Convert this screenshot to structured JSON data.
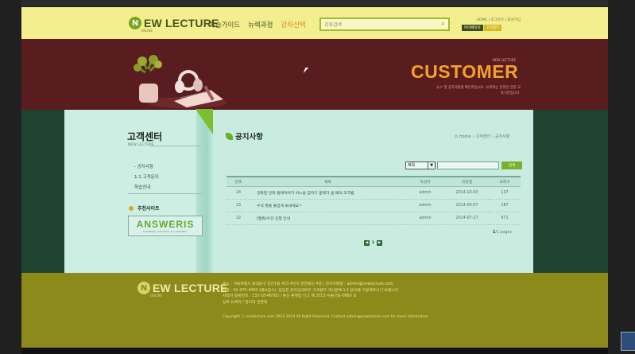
{
  "header": {
    "logo_mark": "N",
    "logo_text": "EW LECTURE",
    "logo_sub": "ONLINE",
    "nav": [
      "학습가이드",
      "뉴렉과정",
      "강좌선택"
    ],
    "search_placeholder": "강좌검색",
    "util_links": "HOME | 로그아웃 | 회원가입",
    "mypage_label": "마이페이지",
    "customer_label": "고객센터"
  },
  "banner": {
    "small": "NEW LECTURE",
    "title": "CUSTOMER",
    "desc": "뉴스 및 공지사항을 확인하십시오. 뉴렉처는 온라인 전문 교육기관입니다."
  },
  "sidebar": {
    "title": "고객센터",
    "subtitle": "NEW LECTURE",
    "menu": [
      "- 공지사항",
      "1:1 고객문의",
      "학습안내"
    ],
    "recommend_label": "추천사이트",
    "banner_logo": "ANSWERIS",
    "banner_sub": "knowledge community & cooperation"
  },
  "board": {
    "title": "공지사항",
    "breadcrumb": [
      "Home",
      "고객센터",
      "공지사항"
    ],
    "filter_value": "제목",
    "search_button": "검색",
    "columns": [
      "번호",
      "제목",
      "작성자",
      "작성일",
      "조회수"
    ],
    "rows": [
      [
        "24",
        "강좌된 강좌 플레이어가 어느날 갑자기 문제가 될 때의 조치법",
        "admin",
        "2014-10-03",
        "137"
      ],
      [
        "23",
        "수석 명을 즐겁게 보내세요~",
        "admin",
        "2014-09-07",
        "187"
      ],
      [
        "22",
        "(필독)수강 신청 안내",
        "admin",
        "2014-07-27",
        "971"
      ]
    ],
    "page_count_current": "1",
    "page_count_rest": "/1 pages",
    "pager_current": "1",
    "pager_prev": "◀",
    "pager_next": "▶"
  },
  "footer": {
    "logo_mark": "N",
    "logo_text": "EW LECTURE",
    "logo_sub": "ONLINE",
    "info_1": "주소 : 서울특별시 동대문구 장안1동 423-4번지 문천빌딩 4층 / 관리자메일 : admin@newlecture.com",
    "info_2": "전화 : 02-470-4060 (월요일시), 입장은 온라인대로은 고객센터 게시판에 1:1 문의를 이용해주시기 바랍니다",
    "info_3": "사업자 등록번호 : 132-18-46763 / 통신 판매업 신고 제 2013-서울강동-0860 호",
    "info_4": "상호 뉴렉처 / 관리자 전경화",
    "copyright": "Copyright ⓒ newlecture.com 2012-2014 All Right Reserved. Contact admin@newlecture.com for more information"
  }
}
